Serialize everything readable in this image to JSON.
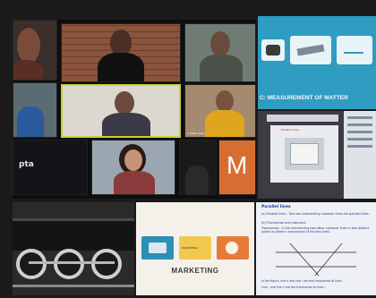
{
  "collage": {
    "meeting_panel": {
      "tiles": [
        {
          "caption": ""
        },
        {
          "caption": ""
        },
        {
          "caption": ""
        },
        {
          "caption": ""
        },
        {
          "caption": ""
        },
        {
          "caption": "T. Nidhi Sahil"
        },
        {
          "caption": ""
        },
        {
          "caption": "pta"
        },
        {
          "caption": ""
        },
        {
          "caption": "M"
        }
      ]
    },
    "slide_top_right": {
      "heading": "C: MEASUREMENT OF MATTER"
    },
    "slide_mid_right": {
      "title": "Paralled lines"
    },
    "slide_marketing": {
      "title": "MARKETING",
      "card_labels": [
        "",
        "MARKETING",
        ""
      ]
    },
    "slide_parallel": {
      "title": "Parallel lines",
      "lines": [
        "(a) Parallel lines : Two non-intersecting coplanar lines are parallel lines.",
        "(b) Transversal and intercept :",
        "Transversal : A line intersecting two other coplanar lines in two distinct points is called a transversal of the two lines.",
        "In the figure, line n and line l are the transversal of lines ",
        "Line - and line n are the transversal to lines..."
      ]
    }
  }
}
